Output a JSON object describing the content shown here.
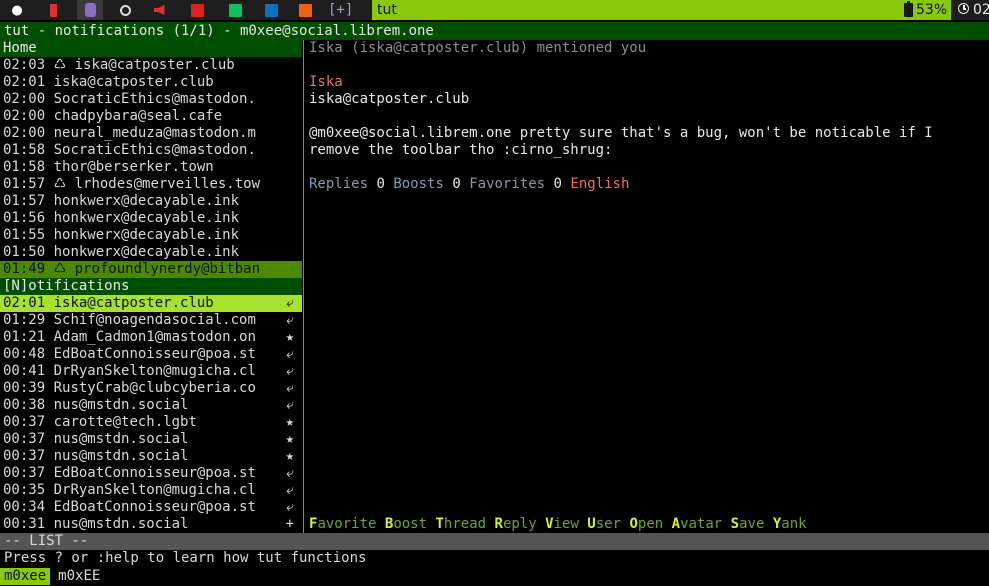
{
  "topbar": {
    "workspaces": [
      {
        "icon": "chat-bubble-icon",
        "glyph": "●",
        "color": "#ffffff"
      },
      {
        "icon": "phone-icon",
        "glyph": "",
        "color": "#e03030"
      },
      {
        "icon": "mastodon-icon",
        "glyph": "",
        "color": "#8b6cc8"
      },
      {
        "icon": "globe-icon",
        "glyph": "",
        "color": "#dddddd"
      },
      {
        "icon": "megaphone-icon",
        "glyph": "",
        "color": "#e03030"
      },
      {
        "icon": "red-square-icon",
        "glyph": "",
        "color": "#e02020"
      },
      {
        "icon": "green-square-icon",
        "glyph": "",
        "color": "#10c060"
      },
      {
        "icon": "blue-square-icon",
        "glyph": "",
        "color": "#1070c0"
      },
      {
        "icon": "orange-square-icon",
        "glyph": "",
        "color": "#f06010"
      }
    ],
    "plus_workspace": "[+]",
    "active_window_title": "tut",
    "battery": "53%",
    "clock": "02"
  },
  "terminal": {
    "title": "tut - notifications (1/1) - m0xee@social.librem.one",
    "home_label": "Home",
    "home_items": [
      {
        "time": "02:03",
        "boost": true,
        "user": "iska@catposter.club"
      },
      {
        "time": "02:01",
        "boost": false,
        "user": "iska@catposter.club"
      },
      {
        "time": "02:00",
        "boost": false,
        "user": "SocraticEthics@mastodon."
      },
      {
        "time": "02:00",
        "boost": false,
        "user": "chadpybara@seal.cafe"
      },
      {
        "time": "02:00",
        "boost": false,
        "user": "neural_meduza@mastodon.m"
      },
      {
        "time": "01:58",
        "boost": false,
        "user": "SocraticEthics@mastodon."
      },
      {
        "time": "01:58",
        "boost": false,
        "user": "thor@berserker.town"
      },
      {
        "time": "01:57",
        "boost": true,
        "user": "lrhodes@merveilles.tow"
      },
      {
        "time": "01:57",
        "boost": false,
        "user": "honkwerx@decayable.ink"
      },
      {
        "time": "01:56",
        "boost": false,
        "user": "honkwerx@decayable.ink"
      },
      {
        "time": "01:55",
        "boost": false,
        "user": "honkwerx@decayable.ink"
      },
      {
        "time": "01:50",
        "boost": false,
        "user": "honkwerx@decayable.ink"
      },
      {
        "time": "01:49",
        "boost": true,
        "user": "profoundlynerdy@bitban",
        "selected": true
      }
    ],
    "notifications_label": "[N]otifications",
    "notification_items": [
      {
        "time": "02:01",
        "user": "iska@catposter.club",
        "type_icon": "⤶",
        "kind": "reply",
        "selected": true
      },
      {
        "time": "01:29",
        "user": "Schif@noagendasocial.com",
        "type_icon": "⤶",
        "kind": "reply"
      },
      {
        "time": "01:21",
        "user": "Adam_Cadmon1@mastodon.on",
        "type_icon": "★",
        "kind": "favorite"
      },
      {
        "time": "00:48",
        "user": "EdBoatConnoisseur@poa.st",
        "type_icon": "⤶",
        "kind": "reply"
      },
      {
        "time": "00:41",
        "user": "DrRyanSkelton@mugicha.cl",
        "type_icon": "⤶",
        "kind": "reply"
      },
      {
        "time": "00:39",
        "user": "RustyCrab@clubcyberia.co",
        "type_icon": "⤶",
        "kind": "reply"
      },
      {
        "time": "00:38",
        "user": "nus@mstdn.social",
        "type_icon": "⤶",
        "kind": "reply"
      },
      {
        "time": "00:37",
        "user": "carotte@tech.lgbt",
        "type_icon": "★",
        "kind": "favorite"
      },
      {
        "time": "00:37",
        "user": "nus@mstdn.social",
        "type_icon": "★",
        "kind": "favorite"
      },
      {
        "time": "00:37",
        "user": "nus@mstdn.social",
        "type_icon": "★",
        "kind": "favorite"
      },
      {
        "time": "00:37",
        "user": "EdBoatConnoisseur@poa.st",
        "type_icon": "⤶",
        "kind": "reply"
      },
      {
        "time": "00:35",
        "user": "DrRyanSkelton@mugicha.cl",
        "type_icon": "⤶",
        "kind": "reply"
      },
      {
        "time": "00:34",
        "user": "EdBoatConnoisseur@poa.st",
        "type_icon": "⤶",
        "kind": "reply"
      },
      {
        "time": "00:31",
        "user": "nus@mstdn.social",
        "type_icon": "+",
        "kind": "follow"
      }
    ],
    "detail": {
      "header": "Iska (iska@catposter.club) mentioned you",
      "display_name": "Iska",
      "handle": "iska@catposter.club",
      "body_lines": [
        "@m0xee@social.librem.one pretty sure that's a bug, won't be noticable if I",
        "remove the toolbar tho :cirno_shrug:"
      ],
      "replies_label": "Replies",
      "replies": "0",
      "boosts_label": "Boosts",
      "boosts": "0",
      "favorites_label": "Favorites",
      "favorites": "0",
      "language": "English"
    },
    "keys": [
      {
        "key": "F",
        "rest": "avorite"
      },
      {
        "key": "B",
        "rest": "oost"
      },
      {
        "key": "T",
        "rest": "hread"
      },
      {
        "key": "R",
        "rest": "eply"
      },
      {
        "key": "V",
        "rest": "iew"
      },
      {
        "key": "U",
        "rest": "ser"
      },
      {
        "key": "O",
        "rest": "pen"
      },
      {
        "key": "A",
        "rest": "vatar"
      },
      {
        "key": "S",
        "rest": "ave"
      },
      {
        "key": "Y",
        "rest": "ank"
      }
    ],
    "mode": "-- LIST --",
    "help": "Press ? or :help to learn how tut functions",
    "account_active": "m0xee",
    "account_other": "m0xEE"
  }
}
